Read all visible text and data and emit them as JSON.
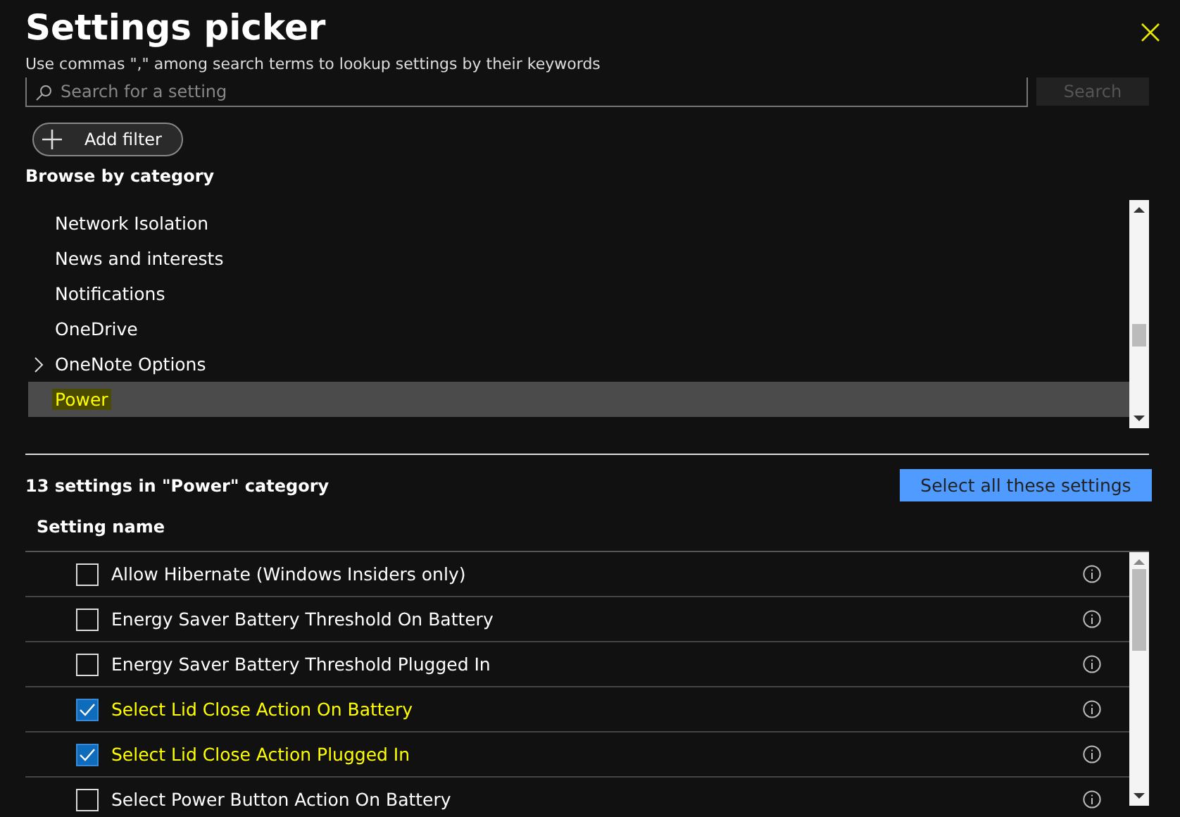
{
  "header": {
    "title": "Settings picker",
    "subtitle": "Use commas \",\" among search terms to lookup settings by their keywords"
  },
  "search": {
    "placeholder": "Search for a setting",
    "button": "Search"
  },
  "add_filter": "Add filter",
  "browse": {
    "heading": "Browse by category",
    "items": [
      {
        "label": "Network Isolation",
        "expandable": false,
        "selected": false
      },
      {
        "label": "News and interests",
        "expandable": false,
        "selected": false
      },
      {
        "label": "Notifications",
        "expandable": false,
        "selected": false
      },
      {
        "label": "OneDrive",
        "expandable": false,
        "selected": false
      },
      {
        "label": "OneNote Options",
        "expandable": true,
        "selected": false
      },
      {
        "label": "Power",
        "expandable": false,
        "selected": true
      }
    ]
  },
  "settings": {
    "count_label": "13 settings in \"Power\" category",
    "select_all": "Select all these settings",
    "column": "Setting name",
    "rows": [
      {
        "name": "Allow Hibernate (Windows Insiders only)",
        "checked": false
      },
      {
        "name": "Energy Saver Battery Threshold On Battery",
        "checked": false
      },
      {
        "name": "Energy Saver Battery Threshold Plugged In",
        "checked": false
      },
      {
        "name": "Select Lid Close Action On Battery",
        "checked": true
      },
      {
        "name": "Select Lid Close Action Plugged In",
        "checked": true
      },
      {
        "name": "Select Power Button Action On Battery",
        "checked": false
      }
    ]
  }
}
